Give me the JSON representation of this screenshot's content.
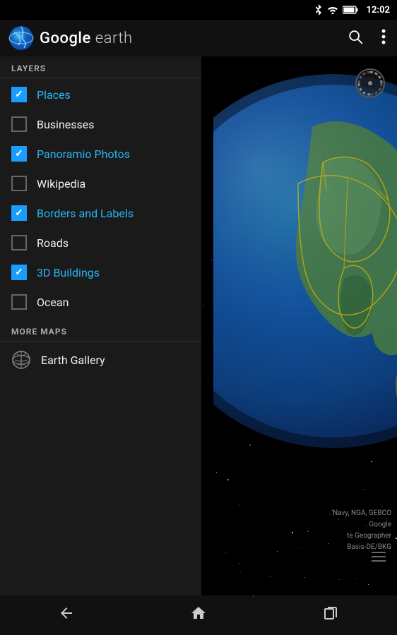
{
  "statusBar": {
    "time": "12:02",
    "icons": [
      "bluetooth",
      "wifi",
      "battery"
    ]
  },
  "appBar": {
    "title": "Google earth",
    "searchLabel": "search",
    "moreLabel": "more options"
  },
  "layers": {
    "sectionLabel": "LAYERS",
    "items": [
      {
        "id": "places",
        "label": "Places",
        "checked": true,
        "active": true
      },
      {
        "id": "businesses",
        "label": "Businesses",
        "checked": false,
        "active": false
      },
      {
        "id": "panoramio",
        "label": "Panoramio Photos",
        "checked": true,
        "active": true
      },
      {
        "id": "wikipedia",
        "label": "Wikipedia",
        "checked": false,
        "active": false
      },
      {
        "id": "borders",
        "label": "Borders and Labels",
        "checked": true,
        "active": true
      },
      {
        "id": "roads",
        "label": "Roads",
        "checked": false,
        "active": false
      },
      {
        "id": "buildings",
        "label": "3D Buildings",
        "checked": true,
        "active": true
      },
      {
        "id": "ocean",
        "label": "Ocean",
        "checked": false,
        "active": false
      }
    ]
  },
  "moreMaps": {
    "sectionLabel": "MORE MAPS",
    "items": [
      {
        "id": "earth-gallery",
        "label": "Earth Gallery"
      }
    ]
  },
  "watermark": {
    "lines": [
      ". Navy, NGA, GEBCO",
      ". Google",
      "te Geographer",
      "Basis-DE/BKG"
    ]
  },
  "navBar": {
    "back": "←",
    "home": "⌂",
    "recent": "▭"
  }
}
